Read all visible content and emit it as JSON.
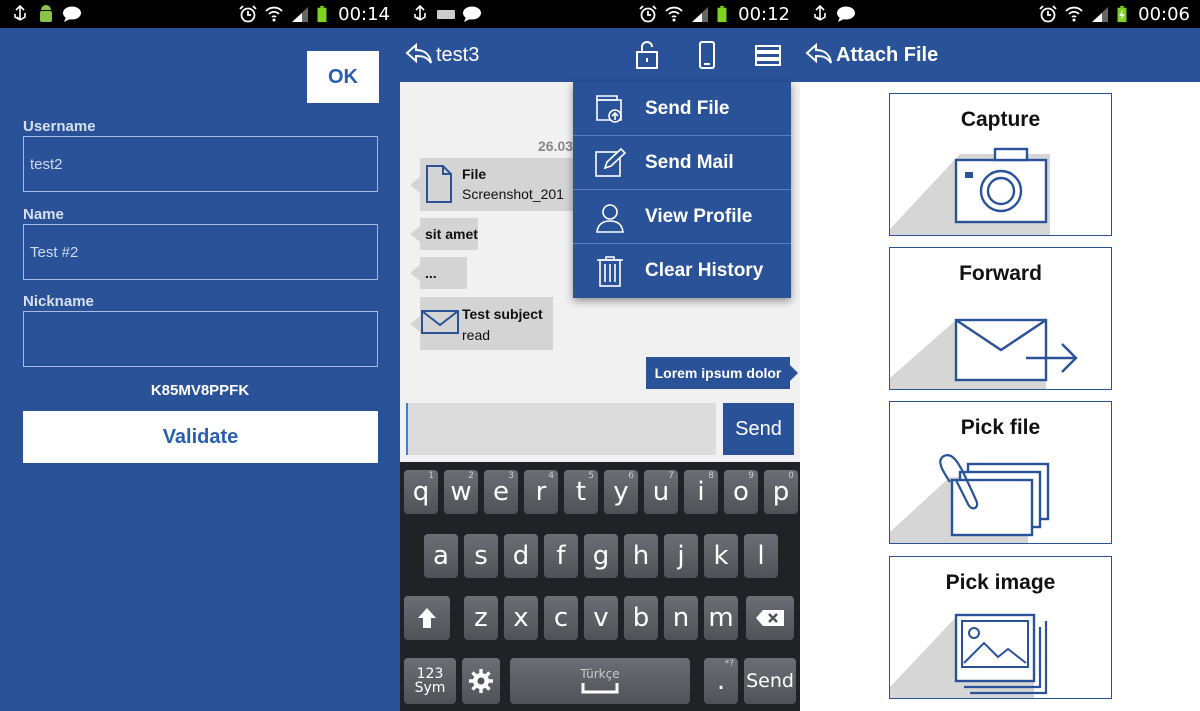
{
  "screen1": {
    "status_time": "00:14",
    "ok_label": "OK",
    "username_label": "Username",
    "username_value": "test2",
    "name_label": "Name",
    "name_value": "Test #2",
    "nickname_label": "Nickname",
    "nickname_value": "",
    "code": "K85MV8PPFK",
    "validate_label": "Validate"
  },
  "screen2": {
    "status_time": "00:12",
    "title": "test3",
    "date": "26.03",
    "messages": {
      "file_title": "File",
      "file_name": "Screenshot_201",
      "sit_amet": "sit amet",
      "ellipsis": "...",
      "mail_subject": "Test subject",
      "mail_status": "read",
      "outgoing": "Lorem ipsum dolor"
    },
    "input_value": "",
    "send_label": "Send",
    "menu": [
      {
        "label": "Send File",
        "icon": "send-file-icon"
      },
      {
        "label": "Send Mail",
        "icon": "send-mail-icon"
      },
      {
        "label": "View Profile",
        "icon": "profile-icon"
      },
      {
        "label": "Clear History",
        "icon": "trash-icon"
      }
    ],
    "keyboard": {
      "row1": [
        "q",
        "w",
        "e",
        "r",
        "t",
        "y",
        "u",
        "i",
        "o",
        "p"
      ],
      "row1_sup": [
        "1",
        "2",
        "3",
        "4",
        "5",
        "6",
        "7",
        "8",
        "9",
        "0"
      ],
      "row2": [
        "a",
        "s",
        "d",
        "f",
        "g",
        "h",
        "j",
        "k",
        "l"
      ],
      "row3": [
        "z",
        "x",
        "c",
        "v",
        "b",
        "n",
        "m"
      ],
      "sym_top": "123",
      "sym_bottom": "Sym",
      "space_label": "Türkçe",
      "period": ".",
      "period_sup": "*?",
      "send_key": "Send"
    }
  },
  "screen3": {
    "status_time": "00:06",
    "title": "Attach File",
    "tiles": [
      {
        "label": "Capture",
        "icon": "camera-icon"
      },
      {
        "label": "Forward",
        "icon": "forward-mail-icon"
      },
      {
        "label": "Pick file",
        "icon": "files-icon"
      },
      {
        "label": "Pick image",
        "icon": "image-icon"
      }
    ]
  },
  "colors": {
    "brand_blue": "#2a5298",
    "bubble_gray": "#d4d4d4",
    "keyboard_bg": "#202226"
  }
}
